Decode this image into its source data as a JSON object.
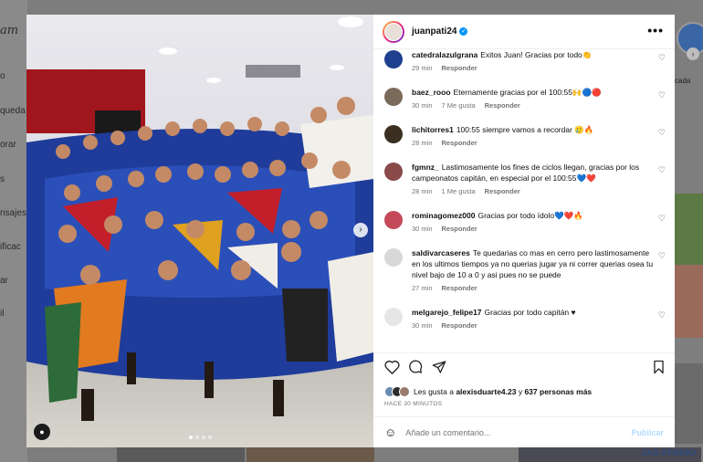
{
  "background": {
    "logo_text": "am",
    "nav_items": [
      "o",
      "queda",
      "orar",
      "s",
      "nsajes",
      "ificac",
      "ar",
      "il"
    ],
    "right_label": "cada",
    "bottom_text": "JAS ATORIO"
  },
  "post": {
    "username": "juanpati24",
    "verified": "✓",
    "more": "•••",
    "carousel_next": "›",
    "carousel_dots": 4,
    "carousel_active": 1
  },
  "comments": [
    {
      "user": "catedralazulgrana",
      "text": "Exitos Juan! Gracias por todo👏",
      "time": "29 min",
      "likes": "",
      "reply": "Responder",
      "avatar_color": "#1f3f8f"
    },
    {
      "user": "baez_rooo",
      "text": "Eternamente gracias por el 100:55🙌🔵🔴",
      "time": "30 min",
      "likes": "7 Me gusta",
      "reply": "Responder",
      "avatar_color": "#7a6a5a"
    },
    {
      "user": "lichitorres1",
      "text": "100:55 siempre vamos a recordar 🥲🔥",
      "time": "28 min",
      "likes": "",
      "reply": "Responder",
      "avatar_color": "#3b2f22"
    },
    {
      "user": "fgmnz_",
      "text": "Lastimosamente los fines de ciclos llegan, gracias por los campeonatos capitán, en especial por el 100:55💙❤️",
      "time": "28 min",
      "likes": "1 Me gusta",
      "reply": "Responder",
      "avatar_color": "#8a4a4a"
    },
    {
      "user": "rominagomez000",
      "text": "Gracias por todo ídolo💙❤️🔥",
      "time": "30 min",
      "likes": "",
      "reply": "Responder",
      "avatar_color": "#c44a5a"
    },
    {
      "user": "saldivarcaseres",
      "text": "Te quedarias co mas en cerro pero lastimosamente en los ultimos tiempos ya no querias jugar ya ni correr querias osea tu nivel bajo de 10 a 0 y asi pues no se puede",
      "time": "27 min",
      "likes": "",
      "reply": "Responder",
      "avatar_color": "#d8d8d8"
    },
    {
      "user": "melgarejo_felipe17",
      "text": "Gracias por todo capitán ♥",
      "time": "30 min",
      "likes": "",
      "reply": "Responder",
      "avatar_color": "#e6e6e6"
    }
  ],
  "likes": {
    "prefix": "Les gusta a ",
    "user": "alexisduarte4.23",
    "middle": " y ",
    "count": "637 personas más"
  },
  "time_ago": "HACE 30 MINUTOS",
  "add_comment": {
    "placeholder": "Añade un comentario...",
    "publish": "Publicar"
  },
  "colors": {
    "verified": "#0095f6",
    "link_muted": "#737373",
    "publish_disabled": "#b3dbff"
  }
}
